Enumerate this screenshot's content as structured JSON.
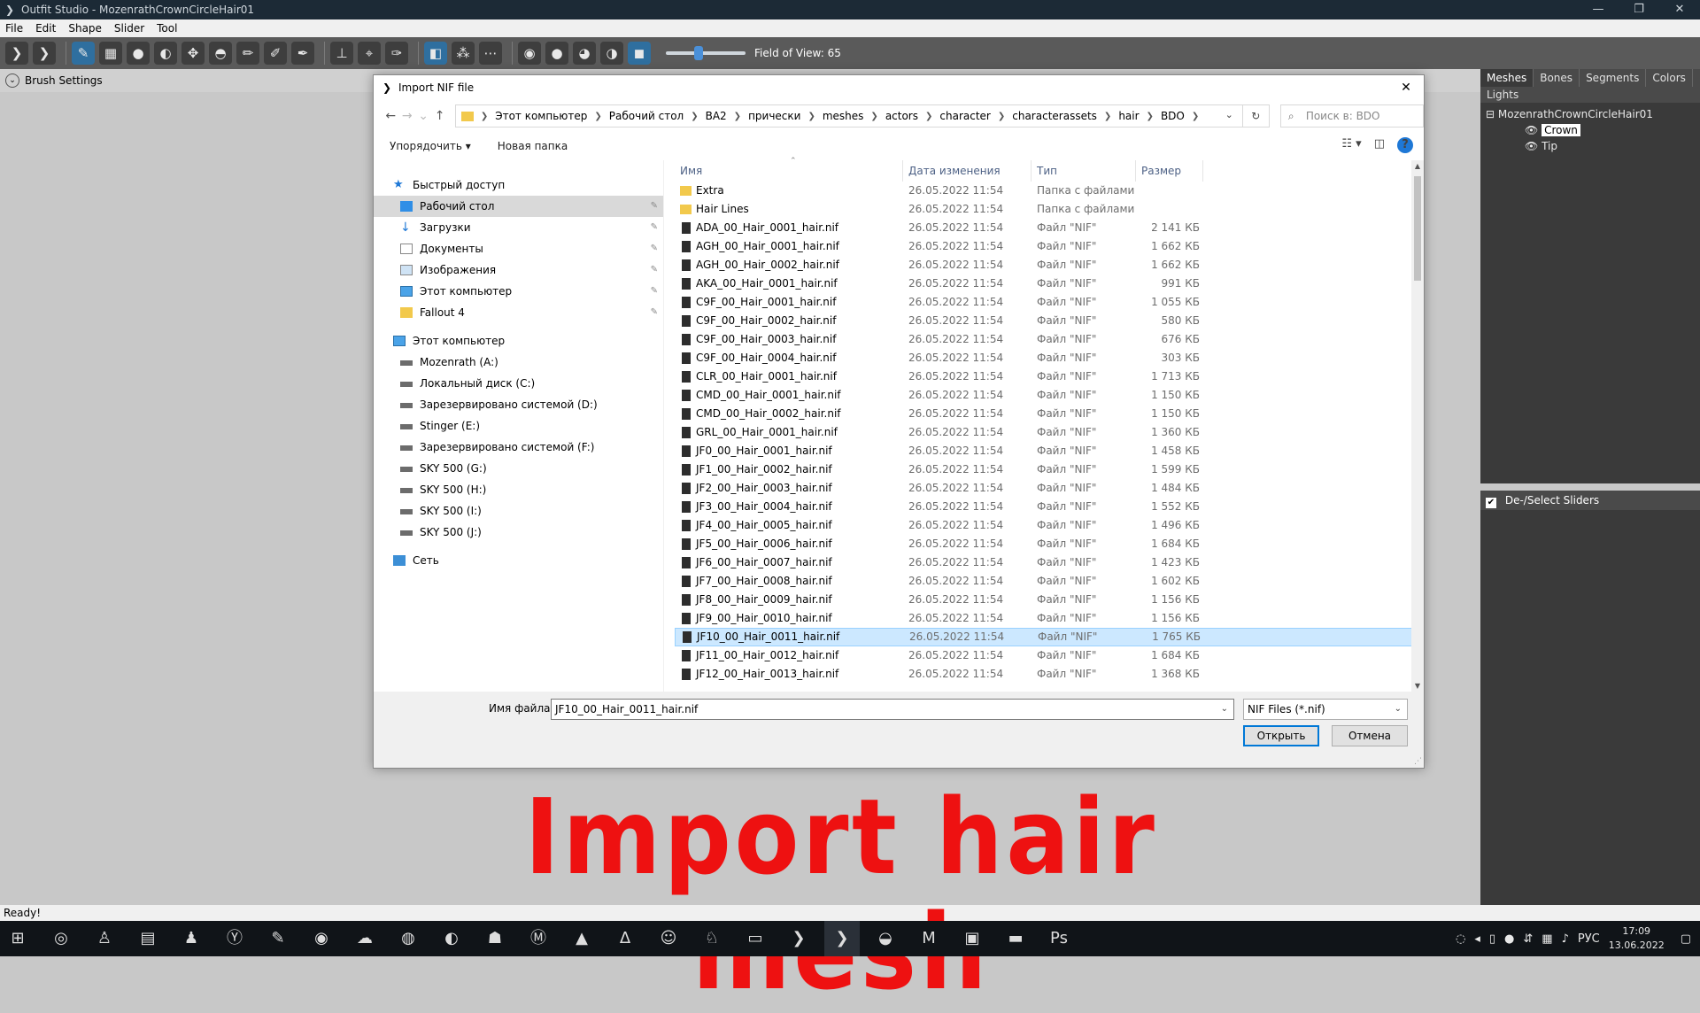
{
  "app": {
    "title": "Outfit Studio - MozenrathCrownCircleHair01",
    "menu": [
      "File",
      "Edit",
      "Shape",
      "Slider",
      "Tool"
    ],
    "fov_label": "Field of View: 65",
    "fov_value": 65,
    "brush_settings": "Brush Settings",
    "status": "Ready!"
  },
  "right_panel": {
    "tabs": [
      "Meshes",
      "Bones",
      "Segments",
      "Colors"
    ],
    "tab2": "Lights",
    "tree_root": "MozenrathCrownCircleHair01",
    "tree_items": [
      "Crown",
      "Tip"
    ],
    "deselect_label": "De-/Select Sliders"
  },
  "overlay_text": "Import hair mesh",
  "dialog": {
    "title": "Import NIF file",
    "breadcrumbs": [
      "Этот компьютер",
      "Рабочий стол",
      "BA2",
      "прически",
      "meshes",
      "actors",
      "character",
      "characterassets",
      "hair",
      "BDO"
    ],
    "search_placeholder": "Поиск в: BDO",
    "commands": [
      "Упорядочить ▾",
      "Новая папка"
    ],
    "nav": [
      {
        "label": "Быстрый доступ",
        "icon": "star",
        "top": true
      },
      {
        "label": "Рабочий стол",
        "icon": "desk",
        "pin": true,
        "selected": true
      },
      {
        "label": "Загрузки",
        "icon": "down",
        "pin": true
      },
      {
        "label": "Документы",
        "icon": "doc",
        "pin": true
      },
      {
        "label": "Изображения",
        "icon": "img",
        "pin": true
      },
      {
        "label": "Этот компьютер",
        "icon": "pc",
        "pin": true
      },
      {
        "label": "Fallout 4",
        "icon": "fold",
        "pin": true
      },
      {
        "label": "Этот компьютер",
        "icon": "pc",
        "top": true,
        "gap": true
      },
      {
        "label": "Mozenrath (A:)",
        "icon": "drive"
      },
      {
        "label": "Локальный диск (C:)",
        "icon": "drive"
      },
      {
        "label": "Зарезервировано системой (D:)",
        "icon": "drive"
      },
      {
        "label": "Stinger (E:)",
        "icon": "drive"
      },
      {
        "label": "Зарезервировано системой (F:)",
        "icon": "drive"
      },
      {
        "label": "SKY 500 (G:)",
        "icon": "drive"
      },
      {
        "label": "SKY 500 (H:)",
        "icon": "drive"
      },
      {
        "label": "SKY 500 (I:)",
        "icon": "drive"
      },
      {
        "label": "SKY 500 (J:)",
        "icon": "drive"
      },
      {
        "label": "Сеть",
        "icon": "net",
        "top": true,
        "gap": true
      }
    ],
    "columns": [
      "Имя",
      "Дата изменения",
      "Тип",
      "Размер"
    ],
    "files": [
      {
        "name": "Extra",
        "date": "26.05.2022 11:54",
        "type": "Папка с файлами",
        "size": "",
        "kind": "folder"
      },
      {
        "name": "Hair Lines",
        "date": "26.05.2022 11:54",
        "type": "Папка с файлами",
        "size": "",
        "kind": "folder"
      },
      {
        "name": "ADA_00_Hair_0001_hair.nif",
        "date": "26.05.2022 11:54",
        "type": "Файл \"NIF\"",
        "size": "2 141 КБ",
        "kind": "nif"
      },
      {
        "name": "AGH_00_Hair_0001_hair.nif",
        "date": "26.05.2022 11:54",
        "type": "Файл \"NIF\"",
        "size": "1 662 КБ",
        "kind": "nif"
      },
      {
        "name": "AGH_00_Hair_0002_hair.nif",
        "date": "26.05.2022 11:54",
        "type": "Файл \"NIF\"",
        "size": "1 662 КБ",
        "kind": "nif"
      },
      {
        "name": "AKA_00_Hair_0001_hair.nif",
        "date": "26.05.2022 11:54",
        "type": "Файл \"NIF\"",
        "size": "991 КБ",
        "kind": "nif"
      },
      {
        "name": "C9F_00_Hair_0001_hair.nif",
        "date": "26.05.2022 11:54",
        "type": "Файл \"NIF\"",
        "size": "1 055 КБ",
        "kind": "nif"
      },
      {
        "name": "C9F_00_Hair_0002_hair.nif",
        "date": "26.05.2022 11:54",
        "type": "Файл \"NIF\"",
        "size": "580 КБ",
        "kind": "nif"
      },
      {
        "name": "C9F_00_Hair_0003_hair.nif",
        "date": "26.05.2022 11:54",
        "type": "Файл \"NIF\"",
        "size": "676 КБ",
        "kind": "nif"
      },
      {
        "name": "C9F_00_Hair_0004_hair.nif",
        "date": "26.05.2022 11:54",
        "type": "Файл \"NIF\"",
        "size": "303 КБ",
        "kind": "nif"
      },
      {
        "name": "CLR_00_Hair_0001_hair.nif",
        "date": "26.05.2022 11:54",
        "type": "Файл \"NIF\"",
        "size": "1 713 КБ",
        "kind": "nif"
      },
      {
        "name": "CMD_00_Hair_0001_hair.nif",
        "date": "26.05.2022 11:54",
        "type": "Файл \"NIF\"",
        "size": "1 150 КБ",
        "kind": "nif"
      },
      {
        "name": "CMD_00_Hair_0002_hair.nif",
        "date": "26.05.2022 11:54",
        "type": "Файл \"NIF\"",
        "size": "1 150 КБ",
        "kind": "nif"
      },
      {
        "name": "GRL_00_Hair_0001_hair.nif",
        "date": "26.05.2022 11:54",
        "type": "Файл \"NIF\"",
        "size": "1 360 КБ",
        "kind": "nif"
      },
      {
        "name": "JF0_00_Hair_0001_hair.nif",
        "date": "26.05.2022 11:54",
        "type": "Файл \"NIF\"",
        "size": "1 458 КБ",
        "kind": "nif"
      },
      {
        "name": "JF1_00_Hair_0002_hair.nif",
        "date": "26.05.2022 11:54",
        "type": "Файл \"NIF\"",
        "size": "1 599 КБ",
        "kind": "nif"
      },
      {
        "name": "JF2_00_Hair_0003_hair.nif",
        "date": "26.05.2022 11:54",
        "type": "Файл \"NIF\"",
        "size": "1 484 КБ",
        "kind": "nif"
      },
      {
        "name": "JF3_00_Hair_0004_hair.nif",
        "date": "26.05.2022 11:54",
        "type": "Файл \"NIF\"",
        "size": "1 552 КБ",
        "kind": "nif"
      },
      {
        "name": "JF4_00_Hair_0005_hair.nif",
        "date": "26.05.2022 11:54",
        "type": "Файл \"NIF\"",
        "size": "1 496 КБ",
        "kind": "nif"
      },
      {
        "name": "JF5_00_Hair_0006_hair.nif",
        "date": "26.05.2022 11:54",
        "type": "Файл \"NIF\"",
        "size": "1 684 КБ",
        "kind": "nif"
      },
      {
        "name": "JF6_00_Hair_0007_hair.nif",
        "date": "26.05.2022 11:54",
        "type": "Файл \"NIF\"",
        "size": "1 423 КБ",
        "kind": "nif"
      },
      {
        "name": "JF7_00_Hair_0008_hair.nif",
        "date": "26.05.2022 11:54",
        "type": "Файл \"NIF\"",
        "size": "1 602 КБ",
        "kind": "nif"
      },
      {
        "name": "JF8_00_Hair_0009_hair.nif",
        "date": "26.05.2022 11:54",
        "type": "Файл \"NIF\"",
        "size": "1 156 КБ",
        "kind": "nif"
      },
      {
        "name": "JF9_00_Hair_0010_hair.nif",
        "date": "26.05.2022 11:54",
        "type": "Файл \"NIF\"",
        "size": "1 156 КБ",
        "kind": "nif"
      },
      {
        "name": "JF10_00_Hair_0011_hair.nif",
        "date": "26.05.2022 11:54",
        "type": "Файл \"NIF\"",
        "size": "1 765 КБ",
        "kind": "nif",
        "selected": true
      },
      {
        "name": "JF11_00_Hair_0012_hair.nif",
        "date": "26.05.2022 11:54",
        "type": "Файл \"NIF\"",
        "size": "1 684 КБ",
        "kind": "nif"
      },
      {
        "name": "JF12_00_Hair_0013_hair.nif",
        "date": "26.05.2022 11:54",
        "type": "Файл \"NIF\"",
        "size": "1 368 КБ",
        "kind": "nif"
      }
    ],
    "filename_label": "Имя файла:",
    "filename_value": "JF10_00_Hair_0011_hair.nif",
    "filetype": "NIF Files (*.nif)",
    "open_label": "Открыть",
    "cancel_label": "Отмена"
  },
  "taskbar": {
    "lang": "РУС",
    "time": "17:09",
    "date": "13.06.2022"
  }
}
